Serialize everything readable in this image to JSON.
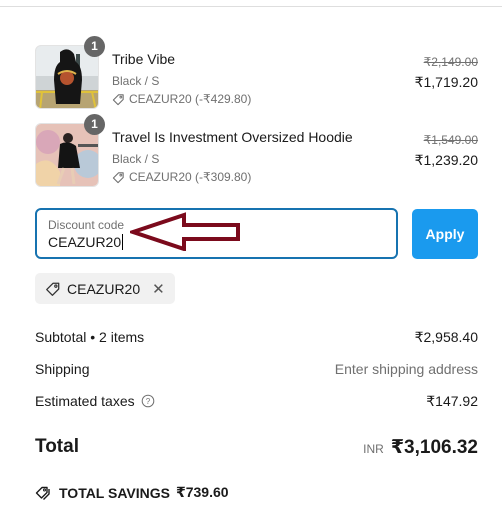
{
  "line_items": [
    {
      "name": "Tribe Vibe",
      "quantity": "1",
      "variant": "Black / S",
      "discount": "CEAZUR20 (-₹429.80)",
      "original_price": "₹2,149.00",
      "price": "₹1,719.20",
      "thumbnail": "black hoodie back print on bridge"
    },
    {
      "name": "Travel Is Investment Oversized Hoodie",
      "quantity": "1",
      "variant": "Black / S",
      "discount": "CEAZUR20 (-₹309.80)",
      "original_price": "₹1,549.00",
      "price": "₹1,239.20",
      "thumbnail": "person in black oversized hoodie against mural"
    }
  ],
  "discount": {
    "label": "Discount code",
    "value": "CEAZUR20",
    "apply_label": "Apply",
    "applied_code": "CEAZUR20",
    "remove_icon": "close-icon"
  },
  "summary": {
    "subtotal_label": "Subtotal • 2 items",
    "subtotal_value": "₹2,958.40",
    "shipping_label": "Shipping",
    "shipping_value": "Enter shipping address",
    "taxes_label": "Estimated taxes",
    "taxes_value": "₹147.92",
    "total_label": "Total",
    "currency": "INR",
    "total_value": "₹3,106.32",
    "savings_label": "TOTAL SAVINGS",
    "savings_value": "₹739.60"
  },
  "colors": {
    "accent": "#1a9aee",
    "field_border": "#1773b0",
    "annotation_arrow": "#7b0a1c"
  }
}
